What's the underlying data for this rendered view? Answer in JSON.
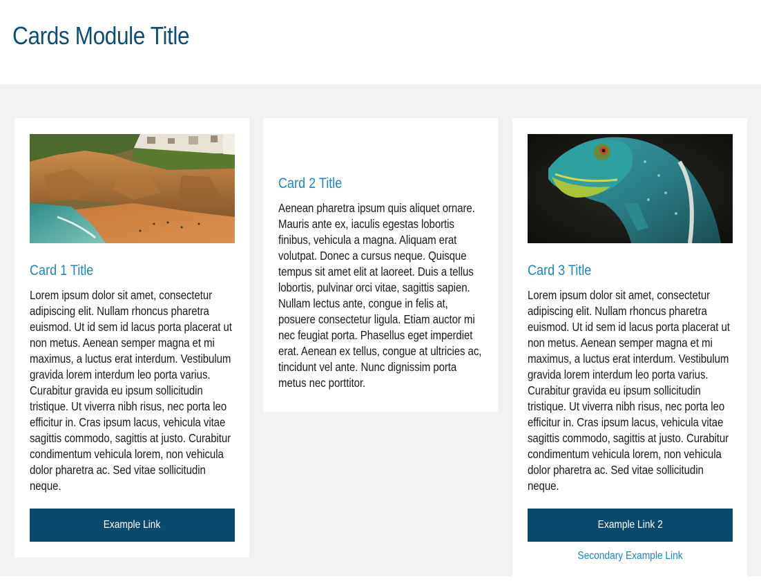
{
  "module": {
    "title": "Cards Module Title"
  },
  "cards": [
    {
      "title": "Card 1 Title",
      "image": "beach-cliff-photo",
      "body": "Lorem ipsum dolor sit amet, consectetur adipiscing elit. Nullam rhoncus pharetra euismod. Ut id sem id lacus porta placerat ut non metus. Aenean semper magna et mi maximus, a luctus erat interdum. Vestibulum gravida lorem interdum leo porta varius. Curabitur gravida eu ipsum sollicitudin tristique. Ut viverra nibh risus, nec porta leo efficitur in. Cras ipsum lacus, vehicula vitae sagittis commodo, sagittis at justo. Curabitur condimentum vehicula lorem, non vehicula dolor pharetra ac. Sed vitae sollicitudin neque.",
      "primary_link": "Example Link"
    },
    {
      "title": "Card 2 Title",
      "body": "Aenean pharetra ipsum quis aliquet ornare. Mauris ante ex, iaculis egestas lobortis finibus, vehicula a magna. Aliquam erat volutpat. Donec a cursus neque. Quisque tempus sit amet elit at laoreet. Duis a tellus lobortis, pulvinar orci vitae, sagittis sapien. Nullam lectus ante, congue in felis at, posuere consectetur ligula. Etiam auctor mi nec feugiat porta. Phasellus eget imperdiet erat. Aenean ex tellus, congue at ultricies ac, tincidunt vel ante. Nunc dignissim porta metus nec porttitor."
    },
    {
      "title": "Card 3 Title",
      "image": "chameleon-photo",
      "body": "Lorem ipsum dolor sit amet, consectetur adipiscing elit. Nullam rhoncus pharetra euismod. Ut id sem id lacus porta placerat ut non metus. Aenean semper magna et mi maximus, a luctus erat interdum. Vestibulum gravida lorem interdum leo porta varius. Curabitur gravida eu ipsum sollicitudin tristique. Ut viverra nibh risus, nec porta leo efficitur in. Cras ipsum lacus, vehicula vitae sagittis commodo, sagittis at justo. Curabitur condimentum vehicula lorem, non vehicula dolor pharetra ac. Sed vitae sollicitudin neque.",
      "primary_link": "Example Link 2",
      "secondary_link": "Secondary Example Link"
    }
  ],
  "colors": {
    "title": "#0d4f73",
    "card_title": "#1a88c2",
    "button_bg": "#0a4a6e",
    "section_bg": "#f2f2f2"
  }
}
